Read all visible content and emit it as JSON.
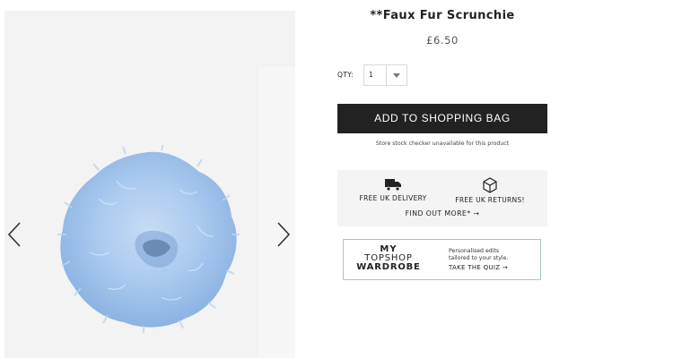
{
  "product": {
    "title": "**Faux Fur Scrunchie",
    "price": "£6.50"
  },
  "gallery": {
    "prev_icon": "chevron-left-icon",
    "next_icon": "chevron-right-icon",
    "image_subject": "light blue faux fur scrunchie"
  },
  "quantity": {
    "label": "QTY:",
    "value": "1",
    "caret_icon": "chevron-down-icon"
  },
  "cart": {
    "add_label": "ADD TO SHOPPING BAG",
    "stock_note": "Store stock checker unavailable for this product"
  },
  "delivery": {
    "uk_delivery": "FREE UK DELIVERY",
    "uk_returns": "FREE UK RETURNS!",
    "find_out_more": "FIND OUT MORE* →",
    "delivery_icon": "truck-icon",
    "returns_icon": "box-icon"
  },
  "wardrobe": {
    "logo_line1": "MY",
    "logo_line2": "TOPSHOP",
    "logo_line3": "WARDROBE",
    "copy_line1": "Personalised edits",
    "copy_line2": "tailored to your style.",
    "cta": "TAKE THE QUIZ →"
  },
  "colors": {
    "button_bg": "#222222",
    "panel_bg": "#f4f4f4",
    "wardrobe_border": "#9ccdc2",
    "scrunchie": "#9fc3ea"
  }
}
